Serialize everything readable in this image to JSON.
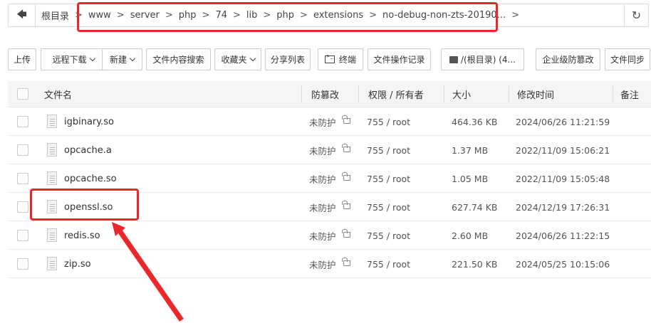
{
  "pathbar": {
    "back_icon": "arrow-left-icon",
    "crumbs": [
      "根目录",
      "www",
      "server",
      "php",
      "74",
      "lib",
      "php",
      "extensions",
      "no-debug-non-zts-20190..."
    ],
    "separator": ">",
    "refresh_icon": "refresh-icon"
  },
  "toolbar": {
    "upload": "上传",
    "remote_download": "远程下载",
    "new": "新建",
    "content_search": "文件内容搜索",
    "favorites": "收藏夹",
    "share_list": "分享列表",
    "terminal": "终端",
    "operation_log": "文件操作记录",
    "drive": "/(根目录) (4...",
    "tamper_proof": "企业级防篡改",
    "file_sync": "文件同步"
  },
  "table": {
    "headers": {
      "name": "文件名",
      "tamper": "防篡改",
      "permission": "权限 / 所有者",
      "size": "大小",
      "modified": "修改时间",
      "remark": "备注"
    },
    "rows": [
      {
        "name": "igbinary.so",
        "tamper": "未防护",
        "permission": "755 / root",
        "size": "464.36 KB",
        "modified": "2024/06/26 11:21:59"
      },
      {
        "name": "opcache.a",
        "tamper": "未防护",
        "permission": "755 / root",
        "size": "1.37 MB",
        "modified": "2022/11/09 15:06:21"
      },
      {
        "name": "opcache.so",
        "tamper": "未防护",
        "permission": "755 / root",
        "size": "1.05 MB",
        "modified": "2022/11/09 15:05:48"
      },
      {
        "name": "openssl.so",
        "tamper": "未防护",
        "permission": "755 / root",
        "size": "627.74 KB",
        "modified": "2024/12/19 17:26:31"
      },
      {
        "name": "redis.so",
        "tamper": "未防护",
        "permission": "755 / root",
        "size": "2.60 MB",
        "modified": "2024/06/26 11:22:15"
      },
      {
        "name": "zip.so",
        "tamper": "未防护",
        "permission": "755 / root",
        "size": "221.50 KB",
        "modified": "2024/05/25 10:15:06"
      }
    ]
  },
  "colors": {
    "annotation": "#e8282b",
    "header_bg": "#f5f5f5"
  }
}
